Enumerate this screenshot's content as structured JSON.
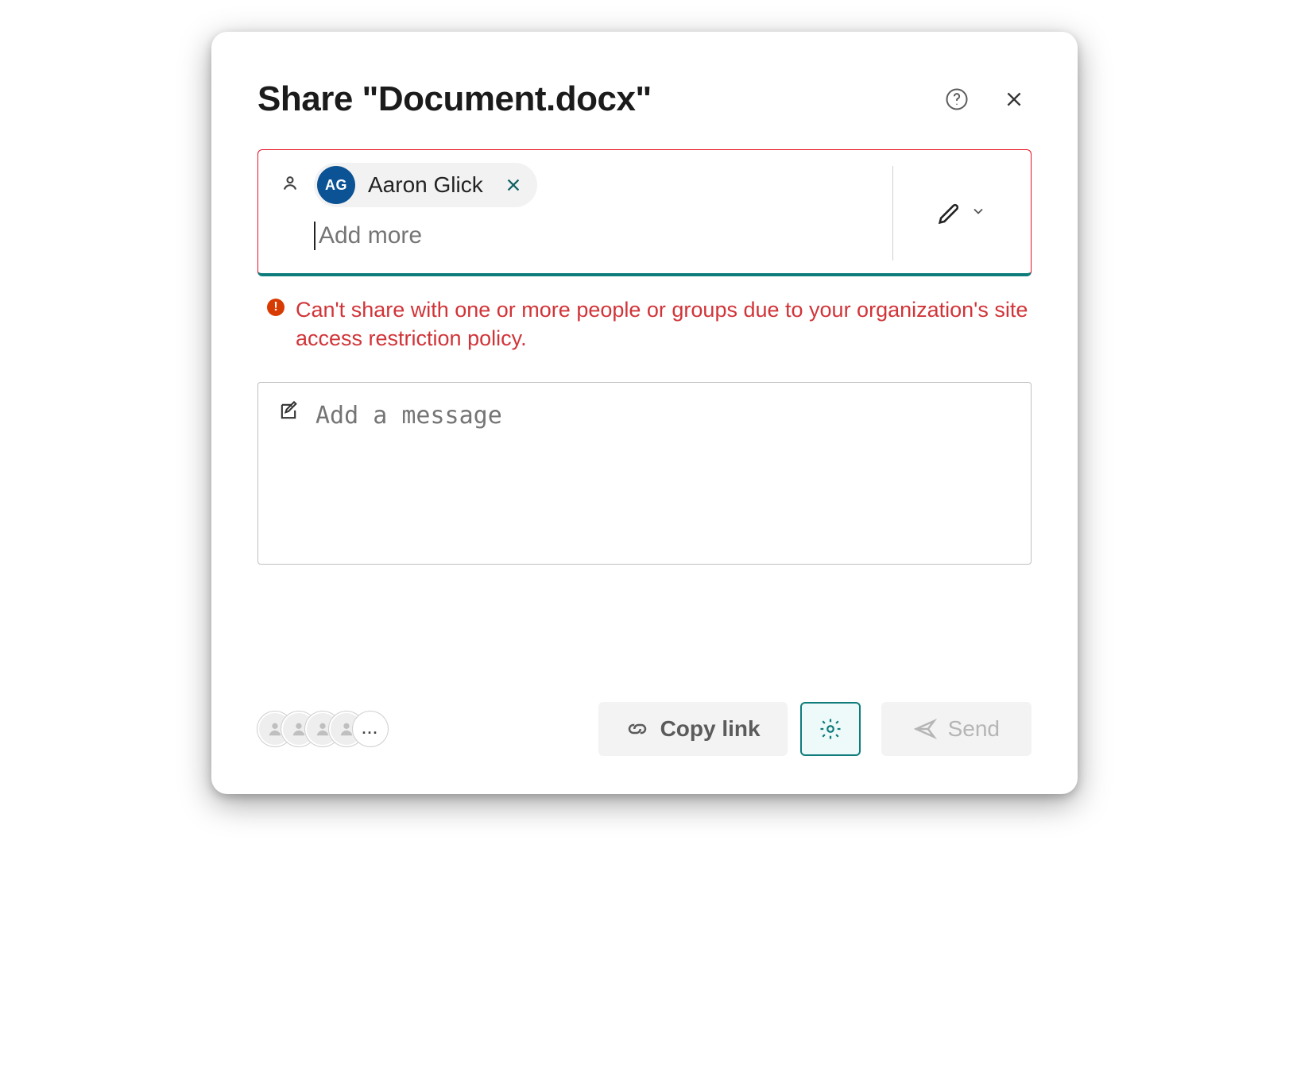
{
  "dialog": {
    "title": "Share \"Document.docx\""
  },
  "recipients": {
    "add_more_placeholder": "Add more",
    "chips": [
      {
        "initials": "AG",
        "name": "Aaron Glick",
        "avatar_bg": "#0b5394"
      }
    ],
    "permission_icon": "pencil-icon"
  },
  "error": {
    "message": "Can't share with one or more people or groups due to your organization's site access restriction policy."
  },
  "message_box": {
    "placeholder": "Add a message"
  },
  "footer": {
    "overflow_label": "...",
    "copy_link_label": "Copy link",
    "send_label": "Send"
  },
  "colors": {
    "error_red": "#d13438",
    "teal_accent": "#0f7c7c",
    "avatar_blue": "#0b5394"
  }
}
